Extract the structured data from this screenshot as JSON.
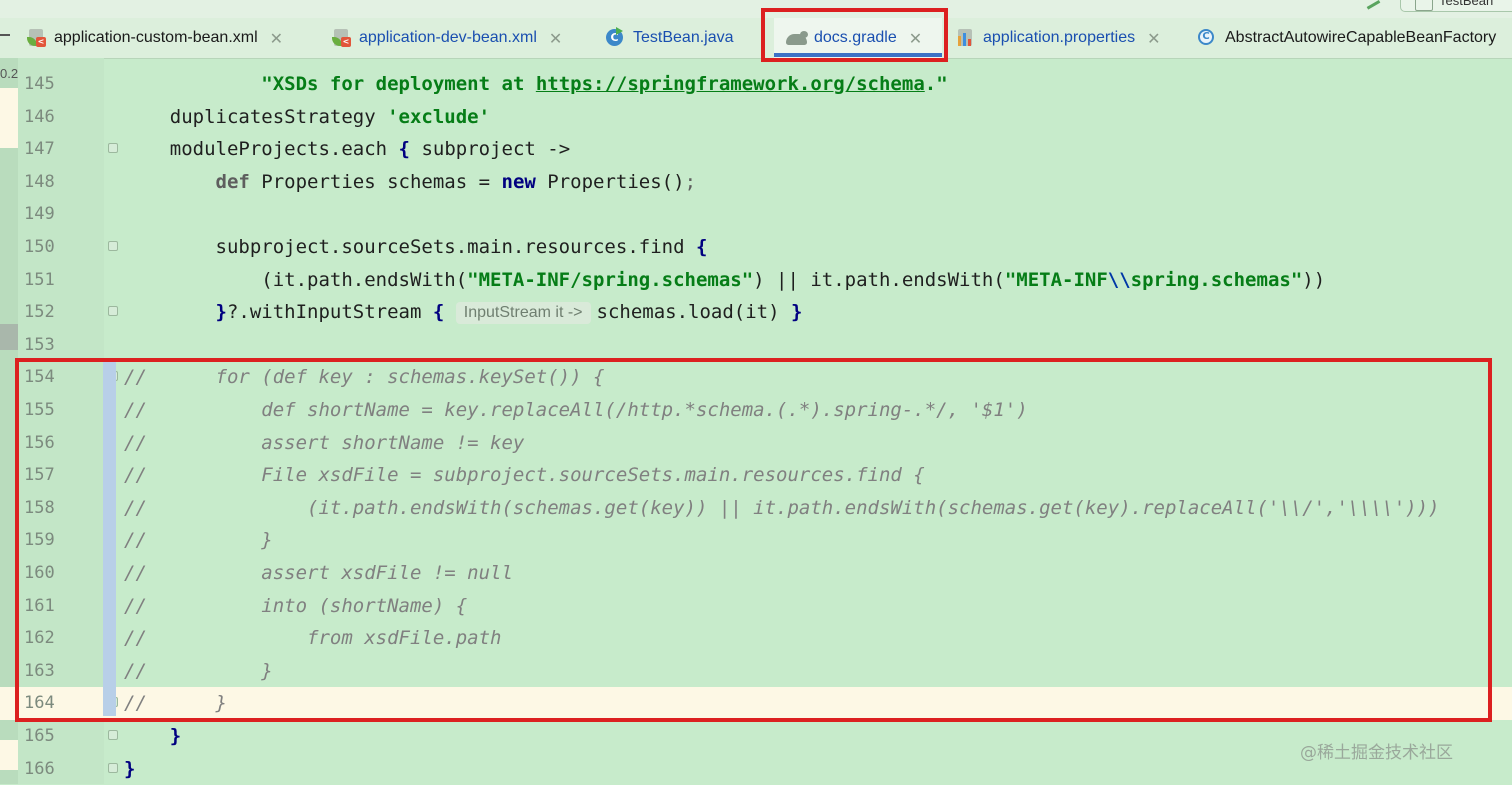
{
  "tabs": [
    {
      "id": "tab-application-custom-bean-xml",
      "label": "application-custom-bean.xml",
      "icon": "xml-file-icon",
      "closable": true,
      "active": false
    },
    {
      "id": "tab-application-dev-bean-xml",
      "label": "application-dev-bean.xml",
      "icon": "xml-file-icon",
      "closable": true,
      "active": false
    },
    {
      "id": "tab-testbean-java",
      "label": "TestBean.java",
      "icon": "java-class-icon",
      "closable": false,
      "active": false
    },
    {
      "id": "tab-docs-gradle",
      "label": "docs.gradle",
      "icon": "gradle-elephant-icon",
      "closable": true,
      "active": true
    },
    {
      "id": "tab-application-properties",
      "label": "application.properties",
      "icon": "properties-file-icon",
      "closable": true,
      "active": false
    },
    {
      "id": "tab-abstract-autowire",
      "label": "AbstractAutowireCapableBeanFactory",
      "icon": "class-icon",
      "closable": false,
      "active": false
    }
  ],
  "top_right_button": "TestBean",
  "left_strip_label": "0.2",
  "inlay_hint": "InputStream it ->",
  "watermark": "@稀土掘金技术社区",
  "colors": {
    "highlight": "#dc2020",
    "editor_bg": "#c7ebcb",
    "current_line": "#fdf8e5",
    "string": "#067d17",
    "keyword": "#000080",
    "comment": "#808080"
  },
  "lines": [
    {
      "n": "145",
      "tokens": [
        [
          "",
          "            "
        ],
        [
          "str",
          "\"XSDs for deployment at "
        ],
        [
          "link",
          "https://springframework.org/schema"
        ],
        [
          "str",
          ".\""
        ]
      ]
    },
    {
      "n": "146",
      "tokens": [
        [
          "",
          "    duplicatesStrategy "
        ],
        [
          "str",
          "'exclude'"
        ]
      ]
    },
    {
      "n": "147",
      "fold": true,
      "tokens": [
        [
          "",
          "    moduleProjects.each "
        ],
        [
          "bold",
          "{"
        ],
        [
          "",
          " subproject ->"
        ]
      ]
    },
    {
      "n": "148",
      "tokens": [
        [
          "",
          "        "
        ],
        [
          "def",
          "def"
        ],
        [
          "",
          " Properties schemas = "
        ],
        [
          "kw",
          "new"
        ],
        [
          "",
          " Properties()"
        ],
        [
          "semi",
          ";"
        ]
      ]
    },
    {
      "n": "149",
      "tokens": []
    },
    {
      "n": "150",
      "fold": true,
      "tokens": [
        [
          "",
          "        subproject.sourceSets.main.resources.find "
        ],
        [
          "bold",
          "{"
        ]
      ]
    },
    {
      "n": "151",
      "tokens": [
        [
          "",
          "            (it.path.endsWith("
        ],
        [
          "str",
          "\"META-INF/spring.schemas\""
        ],
        [
          "",
          ") || it.path.endsWith("
        ],
        [
          "str",
          "\"META-INF"
        ],
        [
          "esc",
          "\\\\"
        ],
        [
          "str",
          "spring.schemas\""
        ],
        [
          "",
          "))"
        ]
      ]
    },
    {
      "n": "152",
      "fold": true,
      "tokens": [
        [
          "",
          "        "
        ],
        [
          "bold",
          "}"
        ],
        [
          "",
          "?.withInputStream "
        ],
        [
          "bold",
          "{"
        ],
        [
          "",
          " "
        ],
        [
          "hint",
          "inlay_hint"
        ],
        [
          "",
          "schemas.load(it) "
        ],
        [
          "bold",
          "}"
        ]
      ]
    },
    {
      "n": "153",
      "tokens": []
    },
    {
      "n": "154",
      "fold": true,
      "comment": true,
      "tokens": [
        [
          "",
          "//      for (def key : schemas.keySet()) {"
        ]
      ]
    },
    {
      "n": "155",
      "comment": true,
      "tokens": [
        [
          "",
          "//          def shortName = key.replaceAll(/http.*schema.(.*).spring-.*/, '$1')"
        ]
      ]
    },
    {
      "n": "156",
      "comment": true,
      "tokens": [
        [
          "",
          "//          assert shortName != key"
        ]
      ]
    },
    {
      "n": "157",
      "comment": true,
      "tokens": [
        [
          "",
          "//          File xsdFile = subproject.sourceSets.main.resources.find {"
        ]
      ]
    },
    {
      "n": "158",
      "comment": true,
      "tokens": [
        [
          "",
          "//              (it.path.endsWith(schemas.get(key)) || it.path.endsWith(schemas.get(key).replaceAll('\\\\/','\\\\\\\\')))"
        ]
      ]
    },
    {
      "n": "159",
      "comment": true,
      "tokens": [
        [
          "",
          "//          }"
        ]
      ]
    },
    {
      "n": "160",
      "comment": true,
      "tokens": [
        [
          "",
          "//          assert xsdFile != null"
        ]
      ]
    },
    {
      "n": "161",
      "comment": true,
      "tokens": [
        [
          "",
          "//          into (shortName) {"
        ]
      ]
    },
    {
      "n": "162",
      "comment": true,
      "tokens": [
        [
          "",
          "//              from xsdFile.path"
        ]
      ]
    },
    {
      "n": "163",
      "comment": true,
      "tokens": [
        [
          "",
          "//          }"
        ]
      ]
    },
    {
      "n": "164",
      "fold": true,
      "comment": true,
      "current": true,
      "tokens": [
        [
          "",
          "//      }"
        ]
      ]
    },
    {
      "n": "165",
      "fold": true,
      "tokens": [
        [
          "",
          "    "
        ],
        [
          "bold",
          "}"
        ]
      ]
    },
    {
      "n": "166",
      "fold": true,
      "tokens": [
        [
          "bold",
          "}"
        ]
      ]
    }
  ]
}
